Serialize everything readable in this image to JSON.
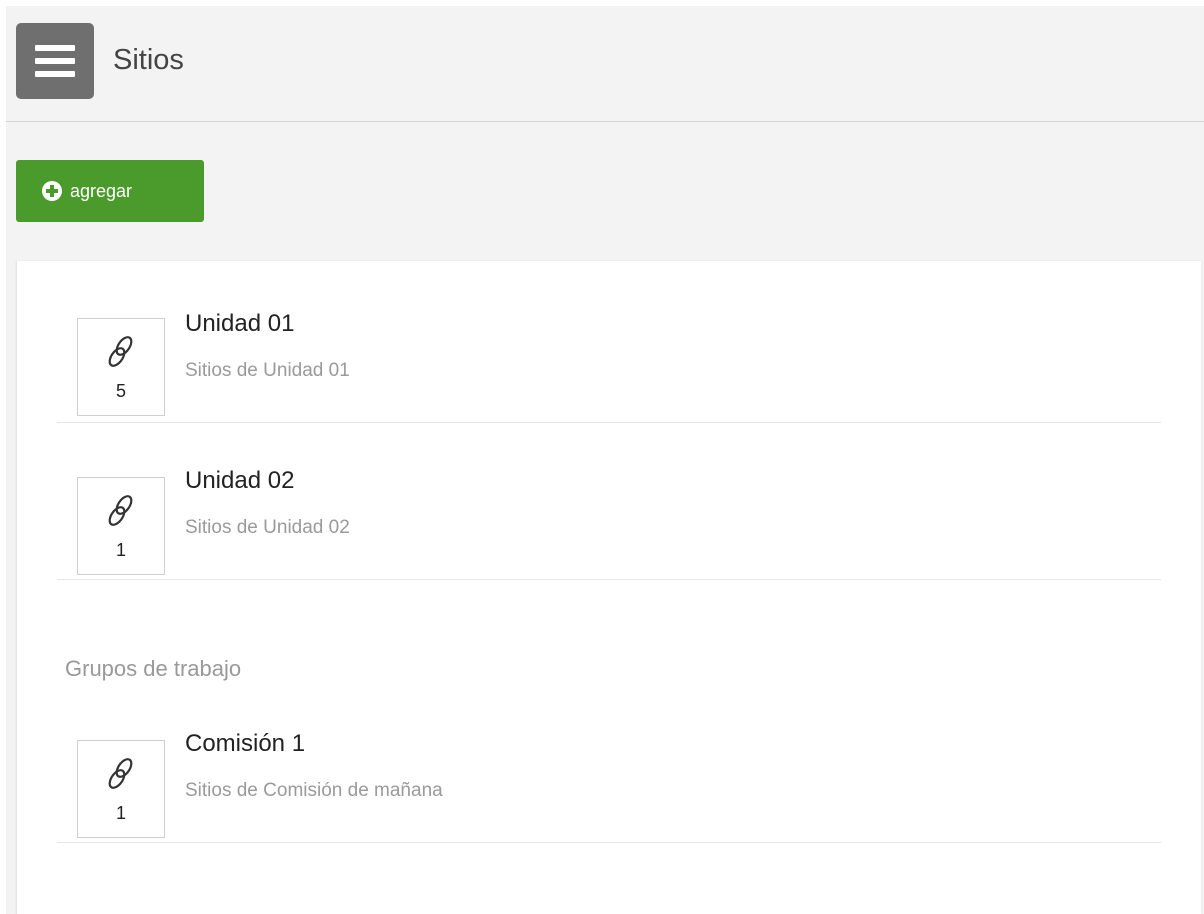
{
  "header": {
    "title": "Sitios",
    "menu_icon": "hamburger-menu-icon"
  },
  "toolbar": {
    "add_label": "agregar",
    "add_icon": "plus-circle-icon",
    "add_color": "#4a9b2c"
  },
  "units": [
    {
      "title": "Unidad 01",
      "subtitle": "Sitios de Unidad 01",
      "count": "5",
      "icon": "link-icon"
    },
    {
      "title": "Unidad 02",
      "subtitle": "Sitios de Unidad 02",
      "count": "1",
      "icon": "link-icon"
    }
  ],
  "groups": {
    "label": "Grupos de trabajo",
    "items": [
      {
        "title": "Comisión 1",
        "subtitle": "Sitios de Comisión de mañana",
        "count": "1",
        "icon": "link-icon"
      }
    ]
  }
}
